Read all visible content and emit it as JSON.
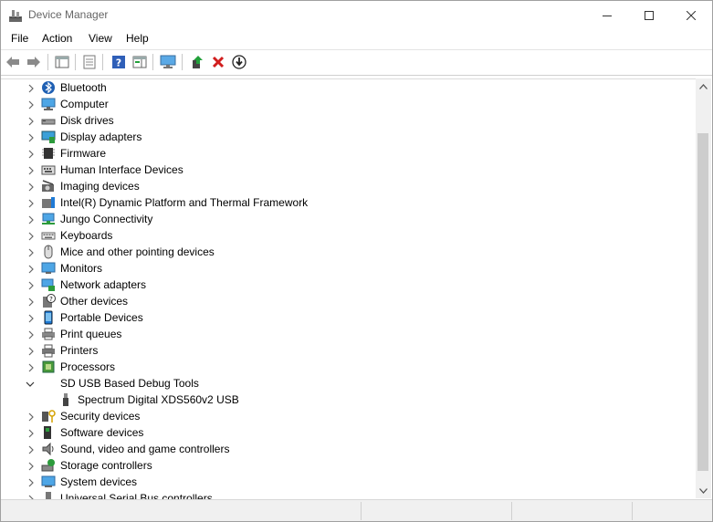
{
  "window": {
    "title": "Device Manager"
  },
  "menu": [
    "File",
    "Action",
    "View",
    "Help"
  ],
  "toolbar_icons": [
    "back-icon",
    "forward-icon",
    "show-hide-tree-icon",
    "properties-icon",
    "help-icon",
    "action-pane-icon",
    "computer-monitor-icon",
    "update-driver-icon",
    "uninstall-icon",
    "scan-hardware-icon"
  ],
  "tree": [
    {
      "label": "Bluetooth",
      "icon": "bluetooth-icon",
      "expanded": false,
      "child": false
    },
    {
      "label": "Computer",
      "icon": "computer-icon",
      "expanded": false,
      "child": false
    },
    {
      "label": "Disk drives",
      "icon": "disk-drive-icon",
      "expanded": false,
      "child": false
    },
    {
      "label": "Display adapters",
      "icon": "display-adapter-icon",
      "expanded": false,
      "child": false
    },
    {
      "label": "Firmware",
      "icon": "firmware-icon",
      "expanded": false,
      "child": false
    },
    {
      "label": "Human Interface Devices",
      "icon": "hid-icon",
      "expanded": false,
      "child": false
    },
    {
      "label": "Imaging devices",
      "icon": "camera-icon",
      "expanded": false,
      "child": false
    },
    {
      "label": "Intel(R) Dynamic Platform and Thermal Framework",
      "icon": "thermal-icon",
      "expanded": false,
      "child": false
    },
    {
      "label": "Jungo Connectivity",
      "icon": "network-icon",
      "expanded": false,
      "child": false
    },
    {
      "label": "Keyboards",
      "icon": "keyboard-icon",
      "expanded": false,
      "child": false
    },
    {
      "label": "Mice and other pointing devices",
      "icon": "mouse-icon",
      "expanded": false,
      "child": false
    },
    {
      "label": "Monitors",
      "icon": "monitor-icon",
      "expanded": false,
      "child": false
    },
    {
      "label": "Network adapters",
      "icon": "network-adapter-icon",
      "expanded": false,
      "child": false
    },
    {
      "label": "Other devices",
      "icon": "unknown-device-icon",
      "expanded": false,
      "child": false
    },
    {
      "label": "Portable Devices",
      "icon": "portable-device-icon",
      "expanded": false,
      "child": false
    },
    {
      "label": "Print queues",
      "icon": "print-queue-icon",
      "expanded": false,
      "child": false
    },
    {
      "label": "Printers",
      "icon": "printer-icon",
      "expanded": false,
      "child": false
    },
    {
      "label": "Processors",
      "icon": "processor-icon",
      "expanded": false,
      "child": false
    },
    {
      "label": "SD USB Based Debug Tools",
      "icon": "",
      "expanded": true,
      "child": false
    },
    {
      "label": "Spectrum Digital XDS560v2 USB",
      "icon": "usb-icon",
      "expanded": false,
      "child": true
    },
    {
      "label": "Security devices",
      "icon": "security-device-icon",
      "expanded": false,
      "child": false
    },
    {
      "label": "Software devices",
      "icon": "software-device-icon",
      "expanded": false,
      "child": false
    },
    {
      "label": "Sound, video and game controllers",
      "icon": "speaker-icon",
      "expanded": false,
      "child": false
    },
    {
      "label": "Storage controllers",
      "icon": "storage-controller-icon",
      "expanded": false,
      "child": false
    },
    {
      "label": "System devices",
      "icon": "system-device-icon",
      "expanded": false,
      "child": false
    },
    {
      "label": "Universal Serial Bus controllers",
      "icon": "usb-controller-icon",
      "expanded": false,
      "child": false
    }
  ],
  "colors": {
    "accent_blue": "#1e7ad6",
    "uninstall_red": "#d11e1e",
    "update_green": "#22a03a"
  }
}
